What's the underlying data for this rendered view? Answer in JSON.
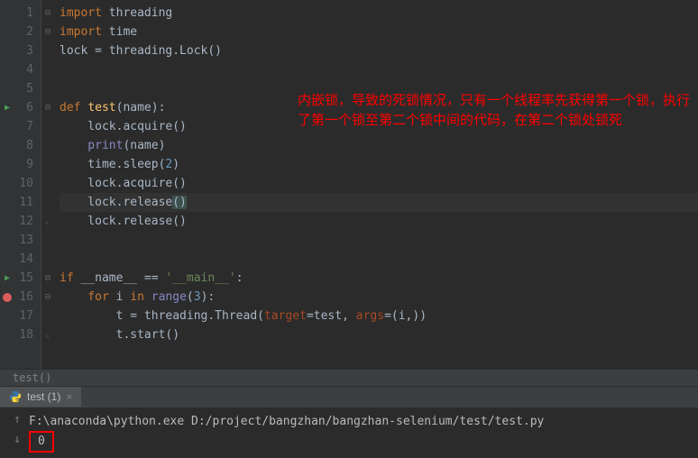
{
  "code": {
    "line1": {
      "kw1": "import ",
      "mod": "threading"
    },
    "line2": {
      "kw1": "import ",
      "mod": "time"
    },
    "line3": {
      "v": "lock = threading.Lock()"
    },
    "line6": {
      "kw1": "def ",
      "name": "test",
      "p": "(name):"
    },
    "line7": {
      "txt": "    lock.acquire()"
    },
    "line8": {
      "fn": "    print",
      "arg": "(name)"
    },
    "line9": {
      "pre": "    time.sleep(",
      "num": "2",
      "post": ")"
    },
    "line10": {
      "txt": "    lock.acquire()"
    },
    "line11": {
      "pre": "    lock.release",
      "paren": "()"
    },
    "line12": {
      "txt": "    lock.release()"
    },
    "line15": {
      "kw1": "if ",
      "dunder": "__name__",
      "eq": " == ",
      "str": "'__main__'",
      "colon": ":"
    },
    "line16": {
      "kw1": "    for ",
      "var": "i",
      "kw2": " in ",
      "fn": "range",
      "p1": "(",
      "num": "3",
      "p2": "):"
    },
    "line17": {
      "pre": "        t = threading.Thread(",
      "kw1": "target",
      "eq1": "=test",
      "c": ", ",
      "kw2": "args",
      "eq2": "=(i",
      "c2": ",",
      "p": "))"
    },
    "line18": {
      "txt": "        t.start()"
    }
  },
  "annotation": {
    "text": "内嵌锁，导致的死锁情况，只有一个线程率先获得第一个锁，执行了第一个锁至第二个锁中间的代码，在第二个锁处锁死"
  },
  "breadcrumb": {
    "text": "test()"
  },
  "tab": {
    "label": "test (1)"
  },
  "console": {
    "cmd": "F:\\anaconda\\python.exe D:/project/bangzhan/bangzhan-selenium/test/test.py",
    "out": "0"
  },
  "line_numbers": [
    "1",
    "2",
    "3",
    "4",
    "5",
    "6",
    "7",
    "8",
    "9",
    "10",
    "11",
    "12",
    "13",
    "14",
    "15",
    "16",
    "17",
    "18"
  ]
}
